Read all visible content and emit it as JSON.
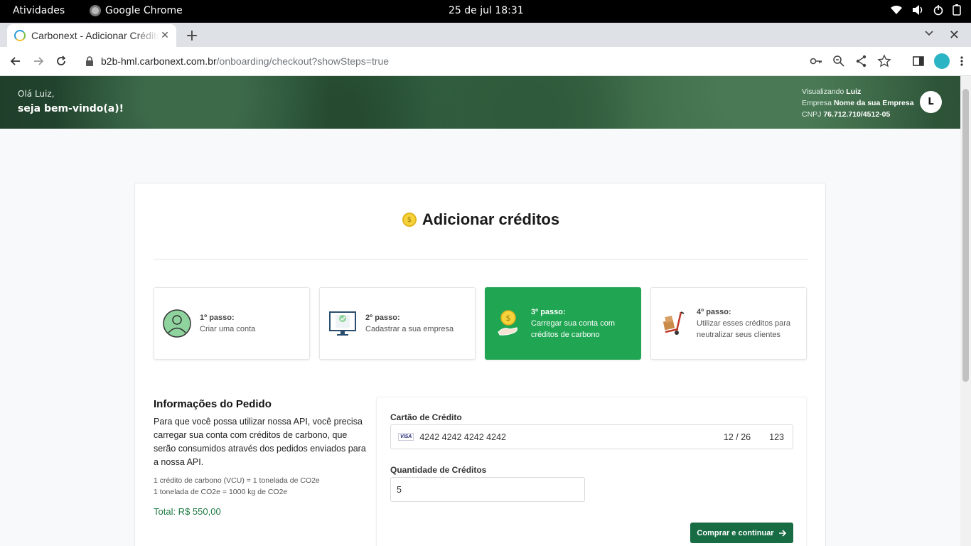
{
  "os": {
    "activities": "Atividades",
    "app_name": "Google Chrome",
    "clock": "25 de jul  18:31"
  },
  "browser": {
    "tab_title": "Carbonext - Adicionar Créditos",
    "url_host": "b2b-hml.carbonext.com.br",
    "url_path": "/onboarding/checkout?showSteps=true"
  },
  "header": {
    "greeting": "Olá Luiz,",
    "welcome": "seja bem-vindo(a)!",
    "viewing_label": "Visualizando",
    "viewing_user": "Luiz",
    "company_label": "Empresa",
    "company_name": "Nome da sua Empresa",
    "cnpj_label": "CNPJ",
    "cnpj_value": "76.712.710/4512-05",
    "avatar_initial": "L"
  },
  "main": {
    "title": "Adicionar créditos",
    "steps": [
      {
        "number": "1º passo:",
        "text": "Criar uma conta",
        "icon": "user-icon"
      },
      {
        "number": "2º passo:",
        "text": "Cadastrar a sua empresa",
        "icon": "monitor-check-icon"
      },
      {
        "number": "3º passo:",
        "text": "Carregar sua conta com créditos de carbono",
        "icon": "coin-hand-icon",
        "active": true
      },
      {
        "number": "4º passo:",
        "text": "Utilizar esses créditos para neutralizar seus clientes",
        "icon": "hand-truck-icon"
      }
    ],
    "order_info": {
      "heading": "Informações do Pedido",
      "description": "Para que você possa utilizar nossa API, você precisa carregar sua conta com créditos de carbono, que serão consumidos através dos pedidos enviados para a nossa API.",
      "note1": "1 crédito de carbono (VCU) = 1 tonelada de CO2e",
      "note2": "1 tonelada de CO2e = 1000 kg de CO2e",
      "total": "Total: R$ 550,00"
    },
    "payment": {
      "card_label": "Cartão de Crédito",
      "card_brand": "VISA",
      "card_number": "4242 4242 4242 4242",
      "card_expiry": "12 / 26",
      "card_cvc": "123",
      "quantity_label": "Quantidade de Créditos",
      "quantity_value": "5",
      "buy_button": "Comprar e continuar"
    }
  },
  "colors": {
    "accent_green": "#20a552",
    "button_green": "#176c43",
    "total_green": "#1d7a43"
  }
}
